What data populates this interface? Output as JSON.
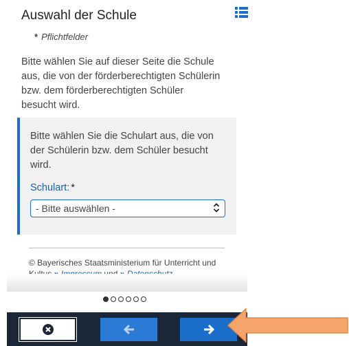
{
  "header": {
    "title": "Auswahl der Schule",
    "required_star": "*",
    "required_label": "Pflichtfelder"
  },
  "intro": "Bitte wählen Sie auf dieser Seite die Schule aus, die von der förderberechtigten Schülerin bzw. dem förderberechtigten Schüler besucht wird.",
  "panel": {
    "text": "Bitte wählen Sie die Schulart aus, die von der Schülerin bzw. dem Schüler besucht wird.",
    "field_label": "Schulart:",
    "field_required": "*",
    "select_value": "- Bitte auswählen -"
  },
  "footer": {
    "copyright": "© Bayerisches Staatsministerium für Unterricht und Kultus",
    "link_impressum": "Impressum",
    "und": "und",
    "link_datenschutz": "Datenschutz"
  },
  "pagination": {
    "current": 1,
    "total": 6
  },
  "colors": {
    "accent": "#1e6fc7",
    "bottom_bar": "#1b2737",
    "callout_arrow": "#f5a46c"
  },
  "icons": {
    "list": "list-icon",
    "cancel": "close-circle-icon",
    "back": "arrow-left-icon",
    "next": "arrow-right-icon"
  }
}
